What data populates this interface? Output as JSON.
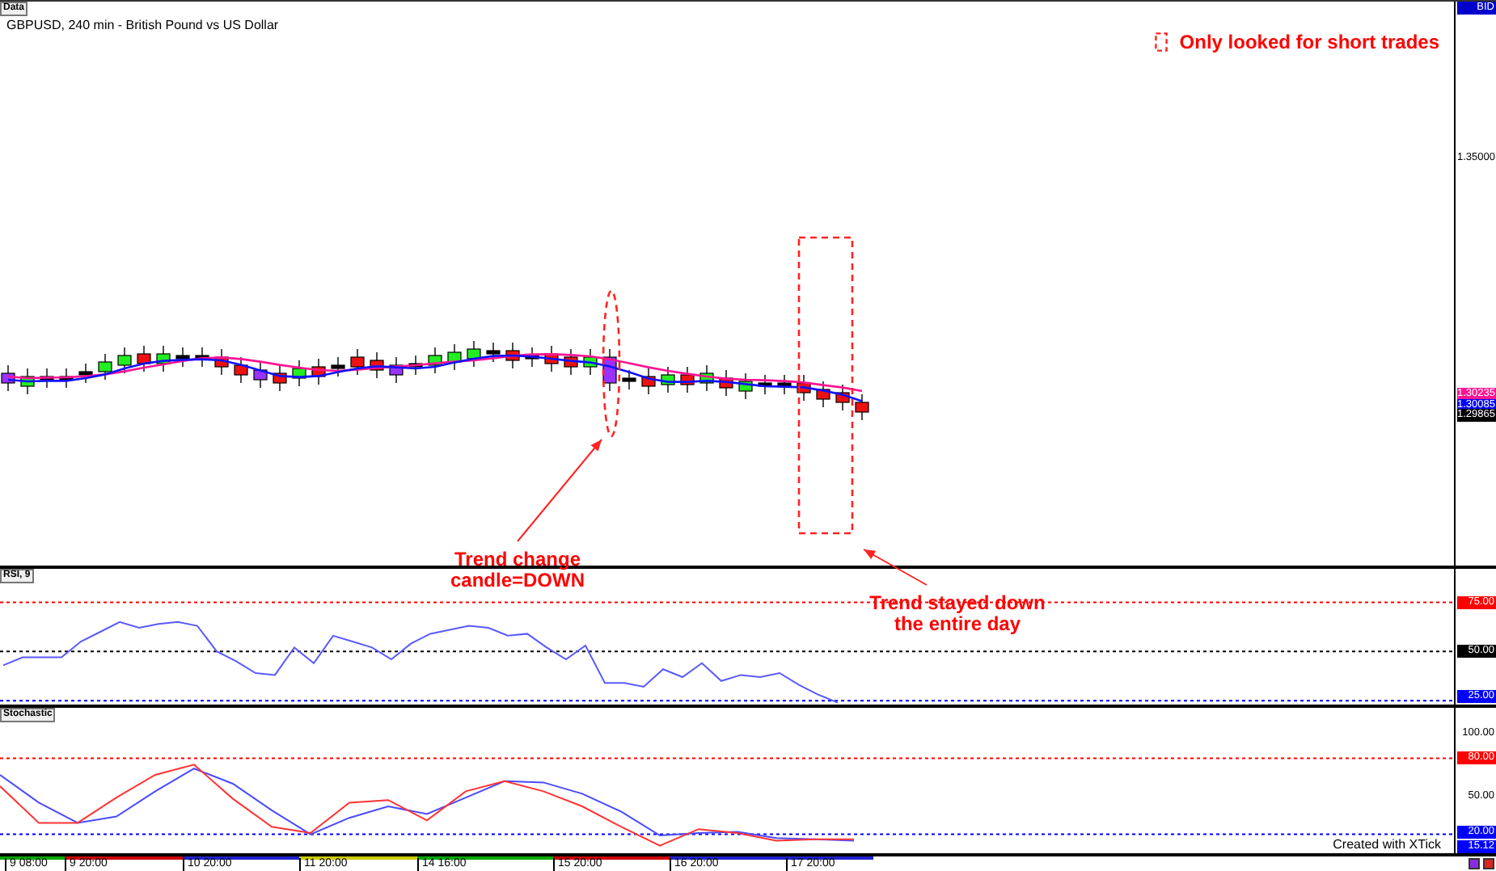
{
  "main_chart": {
    "tab": "Data",
    "title": "GBPUSD, 240 min - British Pound vs US Dollar",
    "legend": {
      "text": "Only looked for short trades"
    },
    "axis_tags": [
      {
        "label": "BID",
        "kind": "header",
        "color": "#0000cc"
      },
      {
        "label": "1.35000",
        "kind": "tick"
      },
      {
        "label": "1.30235",
        "kind": "price",
        "color": "#ff1493"
      },
      {
        "label": "1.30085",
        "kind": "price",
        "color": "#0000ff"
      },
      {
        "label": "1.29865",
        "kind": "price",
        "color": "#000000"
      }
    ]
  },
  "annotations": [
    {
      "kind": "callout",
      "text": "Trend change\ncandle=DOWN"
    },
    {
      "kind": "callout",
      "text": "Trend stayed down\nthe entire day"
    }
  ],
  "rsi": {
    "tab": "RSI, 9",
    "axis_labels": [
      {
        "label": "75.00",
        "kind": "level",
        "color": "#ff0000"
      },
      {
        "label": "50.00",
        "kind": "level",
        "color": "#000000"
      },
      {
        "label": "25.00",
        "kind": "level",
        "color": "#0000ff"
      }
    ]
  },
  "stochastic": {
    "tab": "Stochastic",
    "credit": "Created with XTick",
    "axis_labels": [
      {
        "label": "100.00",
        "kind": "tick"
      },
      {
        "label": "80.00",
        "kind": "level",
        "color": "#ff0000"
      },
      {
        "label": "50.00",
        "kind": "tick"
      },
      {
        "label": "20.00",
        "kind": "level",
        "color": "#0000ff"
      },
      {
        "label": "15.12",
        "kind": "current",
        "color": "#0000ff"
      }
    ]
  },
  "x_axis": {
    "labels": [
      "9 08:00",
      "9 20:00",
      "10 20:00",
      "11 20:00",
      "14 16:00",
      "15 20:00",
      "16 20:00",
      "17 20:00"
    ]
  }
}
